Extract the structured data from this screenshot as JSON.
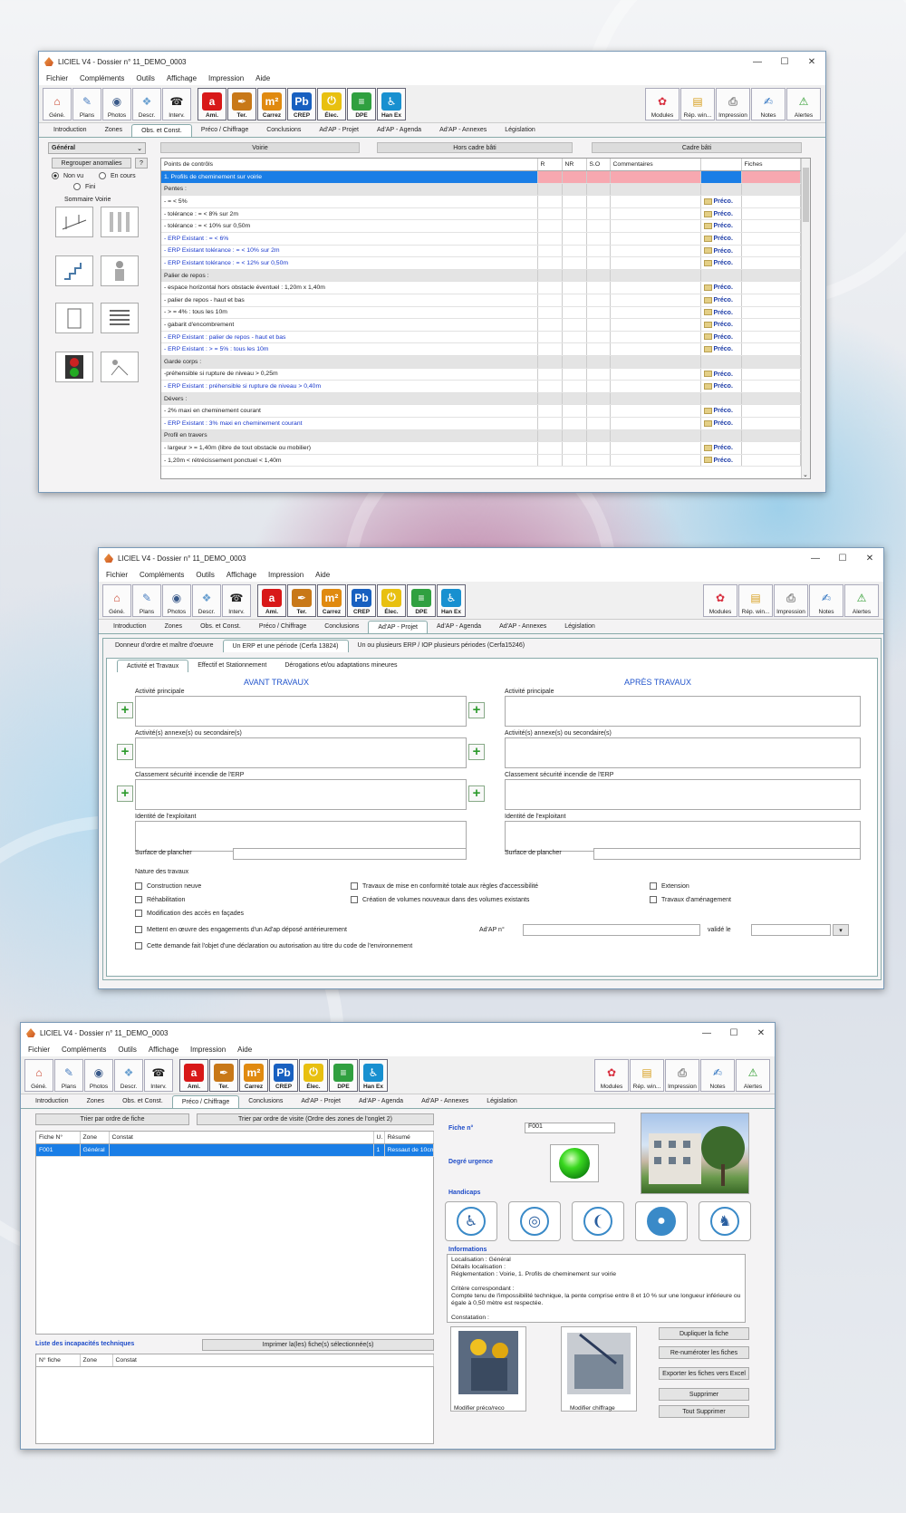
{
  "window_title": "LICIEL V4 - Dossier n° 11_DEMO_0003",
  "window_controls": [
    "—",
    "☐",
    "✕"
  ],
  "menu": [
    "Fichier",
    "Compléments",
    "Outils",
    "Affichage",
    "Impression",
    "Aide"
  ],
  "toolbar_left": [
    {
      "label": "Géné.",
      "icon": "house-icon",
      "color": "#c8402a",
      "glyph": "⌂"
    },
    {
      "label": "Plans",
      "icon": "plans-icon",
      "color": "#4a7ec0",
      "glyph": "✎"
    },
    {
      "label": "Photos",
      "icon": "camera-icon",
      "color": "#3a5a8a",
      "glyph": "◉"
    },
    {
      "label": "Descr.",
      "icon": "description-icon",
      "color": "#6aa0d0",
      "glyph": "❖"
    },
    {
      "label": "Interv.",
      "icon": "intervention-icon",
      "color": "#222222",
      "glyph": "☎"
    },
    {
      "label": "Ami.",
      "icon": "asbestos-icon",
      "color": "#d81818",
      "glyph": "a",
      "colored": true
    },
    {
      "label": "Ter.",
      "icon": "termites-icon",
      "color": "#c87818",
      "glyph": "✒",
      "colored": true
    },
    {
      "label": "Carrez",
      "icon": "carrez-icon",
      "color": "#e08a10",
      "glyph": "m²",
      "colored": true
    },
    {
      "label": "CREP",
      "icon": "lead-icon",
      "color": "#1860c0",
      "glyph": "Pb",
      "colored": true
    },
    {
      "label": "Élec.",
      "icon": "electricity-icon",
      "color": "#e8c010",
      "glyph": "⏻",
      "colored": true
    },
    {
      "label": "DPE",
      "icon": "energy-icon",
      "color": "#30a040",
      "glyph": "≡",
      "colored": true
    },
    {
      "label": "Han Ex",
      "icon": "accessibility-icon",
      "color": "#1890d0",
      "glyph": "♿",
      "colored": true
    }
  ],
  "toolbar_right": [
    {
      "label": "Modules",
      "icon": "modules-icon",
      "color": "#d83040",
      "glyph": "✿"
    },
    {
      "label": "Rép. win...",
      "icon": "folder-icon",
      "color": "#d8a020",
      "glyph": "▤"
    },
    {
      "label": "Impression",
      "icon": "printer-icon",
      "color": "#888888",
      "glyph": "⎙"
    },
    {
      "label": "Notes",
      "icon": "notes-icon",
      "color": "#2a70c0",
      "glyph": "✍"
    },
    {
      "label": "Alertes",
      "icon": "alert-icon",
      "color": "#2a9a2a",
      "glyph": "⚠"
    }
  ],
  "tabs": [
    "Introduction",
    "Zones",
    "Obs. et Const.",
    "Préco / Chiffrage",
    "Conclusions",
    "Ad'AP - Projet",
    "Ad'AP - Agenda",
    "Ad'AP - Annexes",
    "Législation"
  ],
  "w1": {
    "active_tab": "Obs. et Const.",
    "combo": "Général",
    "group_btn": "Regrouper anomalies",
    "help_btn": "?",
    "radios": [
      "Non vu",
      "En cours",
      "Fini"
    ],
    "summary_title": "Sommaire Voirie",
    "sections": [
      "Voirie",
      "Hors cadre bâti",
      "Cadre bâti"
    ],
    "columns": [
      "Points de contrôls",
      "R",
      "NR",
      "S.O",
      "Commentaires",
      "Fiches"
    ],
    "preco": "Préco.",
    "rows": [
      {
        "t": "1. Profils de cheminement sur voirie",
        "k": "sel"
      },
      {
        "t": "Pentes :",
        "k": "cat"
      },
      {
        "t": "- = < 5%",
        "k": "n"
      },
      {
        "t": "- tolérance : = < 8% sur 2m",
        "k": "n"
      },
      {
        "t": "- tolérance : = < 10% sur 0,50m",
        "k": "n"
      },
      {
        "t": "- ERP Existant : = < 6%",
        "k": "b"
      },
      {
        "t": "- ERP Existant tolérance : = < 10% sur 2m",
        "k": "b"
      },
      {
        "t": "- ERP Existant tolérance : = < 12% sur 0,50m",
        "k": "b"
      },
      {
        "t": "Palier de repos :",
        "k": "cat"
      },
      {
        "t": "- espace horizontal hors obstacle éventuel : 1,20m x 1,40m",
        "k": "n"
      },
      {
        "t": "- palier de repos - haut et bas",
        "k": "n"
      },
      {
        "t": "- > = 4% : tous les 10m",
        "k": "n"
      },
      {
        "t": "- gabarit d'encombrement",
        "k": "n"
      },
      {
        "t": "- ERP Existant : palier de repos - haut et bas",
        "k": "b"
      },
      {
        "t": "- ERP Existant : > = 5% : tous les 10m",
        "k": "b"
      },
      {
        "t": "Garde corps :",
        "k": "cat"
      },
      {
        "t": "-préhensible si rupture de niveau > 0,25m",
        "k": "n"
      },
      {
        "t": "- ERP Existant : préhensible si rupture de niveau > 0,40m",
        "k": "b"
      },
      {
        "t": "Dévers :",
        "k": "cat"
      },
      {
        "t": "- 2% maxi en cheminement courant",
        "k": "n"
      },
      {
        "t": "- ERP Existant : 3% maxi en cheminement courant",
        "k": "b"
      },
      {
        "t": "Profil en travers",
        "k": "cat"
      },
      {
        "t": "- largeur > = 1,40m (libre de tout obstacle ou mobilier)",
        "k": "n"
      },
      {
        "t": "- 1,20m < rétrécissement ponctuel < 1,40m",
        "k": "n"
      }
    ]
  },
  "w2": {
    "active_tab": "Ad'AP - Projet",
    "subtabs": [
      "Donneur d'ordre et maître d'oeuvre",
      "Un ERP et une période (Cerfa 13824)",
      "Un ou plusieurs ERP / IOP plusieurs périodes (Cerfa15246)"
    ],
    "subtabs2": [
      "Activité et Travaux",
      "Effectif et Stationnement",
      "Dérogations et/ou adaptations mineures"
    ],
    "before": "AVANT TRAVAUX",
    "after": "APRÈS TRAVAUX",
    "fields": [
      "Activité principale",
      "Activité(s) annexe(s) ou secondaire(s)",
      "Classement sécurité incendie de l'ERP",
      "Identité de l'exploitant"
    ],
    "surface": "Surface de plancher",
    "nature": "Nature des travaux",
    "checks": [
      "Construction neuve",
      "Réhabilitation",
      "Modification des accès en façades",
      "Travaux de mise en conformité totale aux règles d'accessibilité",
      "Création de volumes nouveaux dans des volumes existants",
      "Extension",
      "Travaux d'aménagement"
    ],
    "engage": "Mettent en œuvre des engagements d'un Ad'ap déposé antérieurement",
    "adap_no": "Ad'AP n°",
    "valide": "validé le",
    "env": "Cette demande fait l'objet d'une déclaration ou autorisation au titre du code de l'environnement"
  },
  "w3": {
    "active_tab": "Préco / Chiffrage",
    "sort1": "Trier par ordre de fiche",
    "sort2": "Trier par ordre de visite (Ordre des zones de l'onglet 2)",
    "cols": [
      "Fiche N°",
      "Zone",
      "Constat",
      "U.",
      "Résumé"
    ],
    "row": {
      "fiche": "F001",
      "zone": "Général",
      "constat": "",
      "u": "1",
      "resume": "Ressaut de 10cm"
    },
    "incap": "Liste des incapacités techniques",
    "print": "Imprimer la(les) fiche(s) sélectionnée(s)",
    "cols2": [
      "N° fiche",
      "Zone",
      "Constat"
    ],
    "fiche_label": "Fiche n°",
    "fiche_value": "F001",
    "urgence": "Degré urgence",
    "handicaps": "Handicaps",
    "handicap_icons": [
      "wheelchair-icon",
      "visual-icon",
      "hearing-icon",
      "mental-icon",
      "cognitive-icon"
    ],
    "infos_title": "Informations",
    "infos": [
      "Localisation : Général",
      "Détails localisation :",
      "Réglementation : Voirie, 1. Profils de cheminement sur voirie",
      "",
      "Critère correspondant :",
      "Compte tenu de l'impossibilité technique, la pente comprise entre 8 et 10 % sur une longueur inférieure ou égale à 0,50 mètre est respectée.",
      "",
      "Constatation :"
    ],
    "modify1": "Modifier préco/reco",
    "modify2": "Modifier chiffrage",
    "right_btns": [
      "Dupliquer la fiche",
      "Re-numéroter les fiches",
      "Exporter les fiches vers Excel",
      "Supprimer",
      "Tout Supprimer"
    ]
  }
}
